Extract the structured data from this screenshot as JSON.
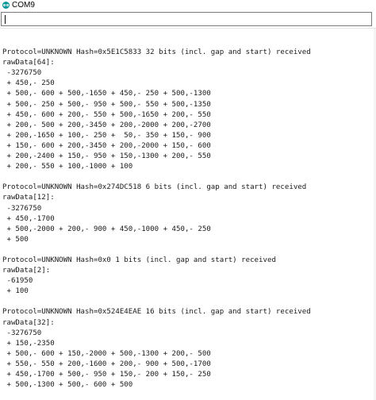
{
  "window": {
    "title": "COM9"
  },
  "send_input": {
    "value": ""
  },
  "output": {
    "lines": [
      "",
      "Protocol=UNKNOWN Hash=0x5E1C5833 32 bits (incl. gap and start) received",
      "rawData[64]:",
      " -3276750",
      " + 450,- 250",
      " + 500,- 600 + 500,-1650 + 450,- 250 + 500,-1300",
      " + 500,- 250 + 500,- 950 + 500,- 550 + 500,-1350",
      " + 450,- 600 + 200,- 550 + 500,-1650 + 200,- 550",
      " + 200,- 500 + 200,-3450 + 200,-2000 + 200,-2700",
      " + 200,-1650 + 100,- 250 +  50,- 350 + 150,- 900",
      " + 150,- 600 + 200,-3450 + 200,-2000 + 150,- 600",
      " + 200,-2400 + 150,- 950 + 150,-1300 + 200,- 550",
      " + 200,- 550 + 100,-1000 + 100",
      "",
      "Protocol=UNKNOWN Hash=0x274DC518 6 bits (incl. gap and start) received",
      "rawData[12]:",
      " -3276750",
      " + 450,-1700",
      " + 500,-2000 + 200,- 900 + 450,-1000 + 450,- 250",
      " + 500",
      "",
      "Protocol=UNKNOWN Hash=0x0 1 bits (incl. gap and start) received",
      "rawData[2]:",
      " -61950",
      " + 100",
      "",
      "Protocol=UNKNOWN Hash=0x524E4EAE 16 bits (incl. gap and start) received",
      "rawData[32]:",
      " -3276750",
      " + 150,-2350",
      " + 500,- 600 + 150,-2000 + 500,-1300 + 200,- 500",
      " + 550,- 550 + 200,-1600 + 200,- 900 + 500,-1700",
      " + 450,-1700 + 500,- 950 + 150,- 200 + 150,- 250",
      " + 500,-1300 + 500,- 600 + 500"
    ]
  }
}
